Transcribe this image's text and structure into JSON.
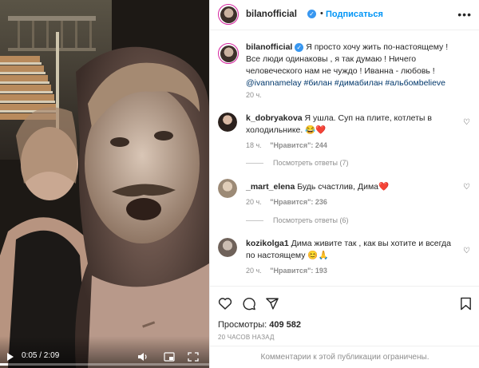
{
  "video": {
    "time": "0:05 / 2:09",
    "progress_fraction": 0.04
  },
  "post": {
    "author": "bilanofficial",
    "follow_label": "Подписаться",
    "separator": "•",
    "caption_username": "bilanofficial",
    "caption_text": "Я просто хочу жить по-настоящему ! Все люди одинаковы , я так думаю ! Ничего человеческого нам не чуждо ! Иванна - любовь !",
    "caption_links": "@ivannamelay #билан #димабилан #альбомbelieve",
    "caption_time": "20 ч."
  },
  "comments": [
    {
      "username": "k_dobryakova",
      "text": "Я ушла. Суп на плите, котлеты в холодильнике. 😂❤️",
      "time": "18 ч.",
      "likes": "\"Нравится\": 244",
      "replies": "Посмотреть ответы (7)"
    },
    {
      "username": "_mart_elena",
      "text": "Будь счастлив, Дима❤️",
      "time": "20 ч.",
      "likes": "\"Нравится\": 236",
      "replies": "Посмотреть ответы (6)"
    },
    {
      "username": "kozikolga1",
      "text": "Дима живите так , как вы хотите и всегда по настоящему 😊🙏",
      "time": "20 ч.",
      "likes": "\"Нравится\": 193"
    }
  ],
  "stats": {
    "views_label": "Просмотры:",
    "views_value": "409 582",
    "posted": "20 ЧАСОВ НАЗАД",
    "comments_limited": "Комментарии к этой публикации ограничены."
  },
  "icons": {
    "heart": "heart-icon",
    "comment": "comment-icon",
    "share": "share-icon",
    "save": "bookmark-icon",
    "more": "more-icon"
  },
  "colors": {
    "link": "#00376b",
    "follow": "#0095f6",
    "verified": "#3897f0",
    "muted": "#8e8e8e",
    "heart": "#ed4956"
  }
}
